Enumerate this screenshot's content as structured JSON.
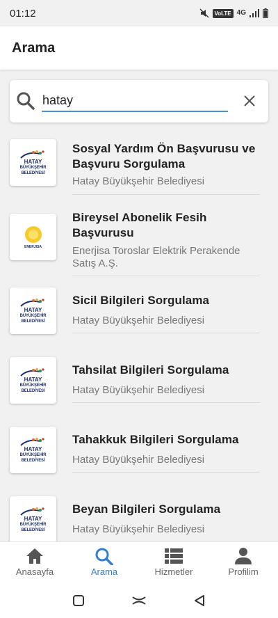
{
  "status_bar": {
    "time": "01:12",
    "volte": "VoLTE",
    "network": "4G"
  },
  "app_bar": {
    "title": "Arama"
  },
  "search": {
    "value": "hatay",
    "placeholder": ""
  },
  "results": [
    {
      "title": "Sosyal Yardım Ön Başvurusu ve Başvuru Sorgulama",
      "subtitle": "Hatay Büyükşehir Belediyesi",
      "logo": "hatay-logo"
    },
    {
      "title": "Bireysel Abonelik Fesih Başvurusu",
      "subtitle": "Enerjisa Toroslar Elektrik Perakende Satış A.Ş.",
      "logo": "enerjisa-logo"
    },
    {
      "title": "Sicil Bilgileri Sorgulama",
      "subtitle": "Hatay Büyükşehir Belediyesi",
      "logo": "hatay-logo"
    },
    {
      "title": "Tahsilat Bilgileri Sorgulama",
      "subtitle": "Hatay Büyükşehir Belediyesi",
      "logo": "hatay-logo"
    },
    {
      "title": "Tahakkuk Bilgileri Sorgulama",
      "subtitle": "Hatay Büyükşehir Belediyesi",
      "logo": "hatay-logo"
    },
    {
      "title": "Beyan Bilgileri Sorgulama",
      "subtitle": "Hatay Büyükşehir Belediyesi",
      "logo": "hatay-logo"
    }
  ],
  "hatay_logo": {
    "line1": "HATAY",
    "line2": "BÜYÜKŞEHİR",
    "line3": "BELEDİYESİ"
  },
  "enerjisa_logo": {
    "text": "ENERJISA"
  },
  "bottom_nav": [
    {
      "label": "Anasayfa",
      "icon": "home-icon",
      "active": false
    },
    {
      "label": "Arama",
      "icon": "search-icon",
      "active": true
    },
    {
      "label": "Hizmetler",
      "icon": "list-icon",
      "active": false
    },
    {
      "label": "Profilim",
      "icon": "person-icon",
      "active": false
    }
  ],
  "colors": {
    "accent": "#2f7fd1",
    "nav_inactive": "#666666",
    "background": "#f1f1f1"
  }
}
